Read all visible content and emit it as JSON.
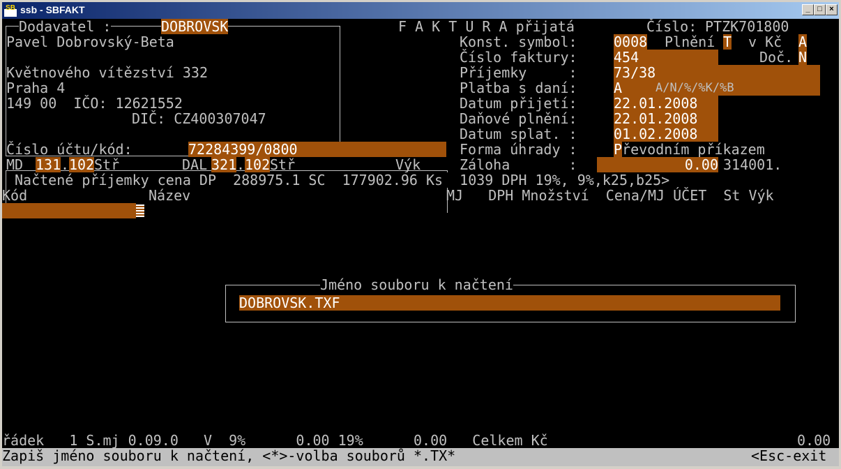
{
  "window": {
    "title": "ssb - SBFAKT",
    "icon_text": "SB",
    "buttons": [
      "_",
      "□",
      "×"
    ]
  },
  "supplier": {
    "label": "Dodavatel :",
    "code": "DOBROVSK",
    "name": "Pavel Dobrovský-Beta",
    "street": "Květnového vítězství 332",
    "city": "Praha 4",
    "zip_ico": "149 00  IČO: 12621552",
    "dic": "DIČ: CZ400307047"
  },
  "header": {
    "title": "F A K T U R A přijatá",
    "number_label": "Číslo:",
    "number": "PTZK701800"
  },
  "invoice": {
    "konst_label": "Konst. symbol:",
    "konst": "0008",
    "plneni_label": "Plnění",
    "plneni": "T",
    "vkc_label": "v Kč",
    "vkc": "A",
    "cislo_label": "Číslo faktury:",
    "cislo": "454",
    "doc_label": "Doč.",
    "doc": "N",
    "prijemky_label": "Příjemky     :",
    "prijemky": "73/38",
    "platba_label": "Platba s daní:",
    "platba": "A",
    "platba_hint": "A/N/%/%K/%B",
    "datum_prijeti_label": "Datum přijetí:",
    "datum_prijeti": "22.01.2008",
    "danove_plneni_label": "Daňové plnění:",
    "danove_plneni": "22.01.2008",
    "datum_splat_label": "Datum splat. :",
    "datum_splat": "01.02.2008",
    "forma_label": "Forma úhrady :",
    "forma": "Převodním příkazem",
    "zaloha_label": "Záloha       :",
    "zaloha": "0.00",
    "zaloha_extra": "314001."
  },
  "account": {
    "label": "Číslo účtu/kód:",
    "value": "72284399/0800",
    "md_label": "MD",
    "md1": "131",
    "md2": "102",
    "str_label": "Stř",
    "dal_label": "DAL",
    "dal1": "321",
    "dal2": "102",
    "vyk_label": "Výk"
  },
  "loaded": "Načtené příjemky cena DP  288975.1 SC  177902.96 Ks  1039 DPH 19%, 9%,k25,b25>",
  "table_header": {
    "kod": "Kód",
    "nazev": "Název",
    "rest": "MJ   DPH Množství  Cena/MJ ÚČET  St Výk"
  },
  "dialog": {
    "title": "Jméno souboru k načtení",
    "value": "DOBROVSK.TXF"
  },
  "footer": {
    "line": "řádek   1 S.mj 0.09.0   V  9%      0.00 19%      0.00   Celkem Kč"
  },
  "footer_total": "0.00",
  "status": {
    "message": "Zapiš jméno souboru k načtení, <*>-volba souborů *.TX*",
    "exit": "<Esc-exit"
  }
}
